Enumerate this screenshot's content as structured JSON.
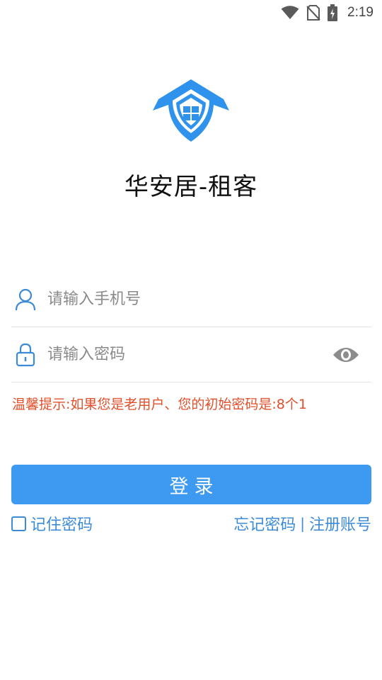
{
  "status_bar": {
    "time": "2:19",
    "icons": [
      "wifi-icon",
      "no-sim-icon",
      "battery-charging-icon"
    ]
  },
  "app": {
    "title": "华安居-租客",
    "logo_icon": "house-shield-logo",
    "accent_color": "#3d9af0"
  },
  "form": {
    "phone": {
      "placeholder": "请输入手机号",
      "value": "",
      "icon": "user-icon"
    },
    "password": {
      "placeholder": "请输入密码",
      "value": "",
      "icon": "lock-icon",
      "toggle_icon": "eye-icon"
    },
    "tip": "温馨提示:如果您是老用户、您的初始密码是:8个1",
    "tip_color": "#e1502b",
    "login_label": "登录",
    "remember_label": "记住密码",
    "remember_checked": false,
    "forgot_label": "忘记密码",
    "separator": "|",
    "register_label": "注册账号"
  }
}
